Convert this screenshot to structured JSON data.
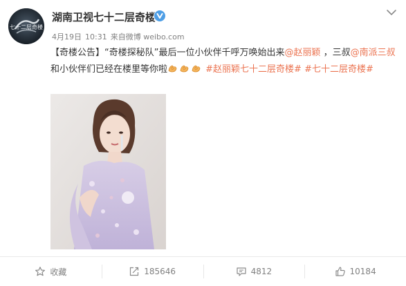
{
  "post": {
    "username": "湖南卫视七十二层奇楼",
    "date": "4月19日",
    "time": "10:31",
    "source_prefix": "来自",
    "source": "微博 weibo.com",
    "avatar_text": "七十二层奇楼",
    "text": {
      "bracket_title": "【奇楼公告】",
      "p1": "“奇楼探秘队”最后一位小伙伴千呼万唤始出来",
      "mention1": "@赵丽颖",
      "p2": " ，三叔",
      "mention2": "@南派三叔",
      "p3": " 和小伙伴们已经在楼里等你啦",
      "hashtag1": "#赵丽颖七十二层奇楼#",
      "hashtag2": "#七十二层奇楼#"
    }
  },
  "actions": {
    "favorite_label": "收藏",
    "repost_count": "185646",
    "comment_count": "4812",
    "like_count": "10184"
  },
  "icons": {
    "verified": "verified-v-icon",
    "chevron": "chevron-down-icon",
    "emoji": "clap-emoji-icon",
    "favorite": "star-icon",
    "repost": "repost-icon",
    "comment": "comment-icon",
    "like": "thumbs-up-icon"
  },
  "colors": {
    "link": "#eb7350",
    "text": "#333333",
    "muted": "#808080",
    "verified": "#4e9ee5"
  }
}
